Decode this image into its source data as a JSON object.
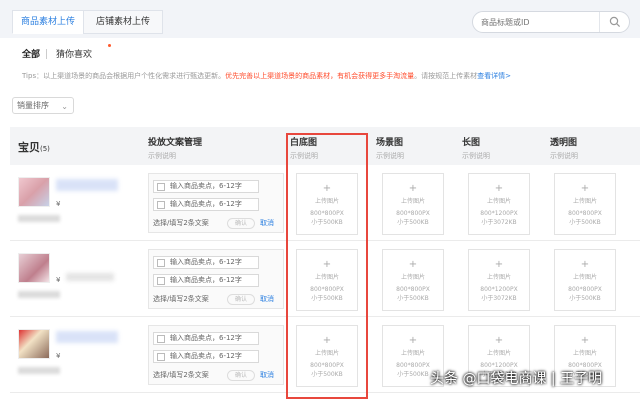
{
  "tabs": [
    {
      "label": "商品素材上传",
      "active": true
    },
    {
      "label": "店铺素材上传",
      "active": false
    }
  ],
  "search": {
    "placeholder": "商品标题或ID"
  },
  "subtabs": [
    "全部",
    "猜你喜欢"
  ],
  "tips": {
    "prefix": "Tips：以上渠道场景的商品会根据用户个性化需求进行甄选更新。",
    "highlight": "优先完善以上渠道场景的商品素材，有机会获得更多手淘流量",
    "suffix": "。请按规范上传素材",
    "link": "查看详情>"
  },
  "sort": {
    "label": "销量排序"
  },
  "table": {
    "product_col": {
      "title": "宝贝",
      "count": "(5)"
    },
    "columns": [
      {
        "title": "投放文案管理",
        "sub": "示例说明"
      },
      {
        "title": "白底图",
        "sub": "示例说明"
      },
      {
        "title": "场景图",
        "sub": "示例说明"
      },
      {
        "title": "长图",
        "sub": "示例说明"
      },
      {
        "title": "透明图",
        "sub": "示例说明"
      }
    ]
  },
  "copy_editor": {
    "input_placeholder": "输入商品卖点，6-12字",
    "footer": "选择/填写2条文案",
    "confirm": "确认",
    "cancel": "取消"
  },
  "upload": {
    "plus": "+",
    "label": "上传图片",
    "size_800": "800*800PX",
    "size_1200": "800*1200PX",
    "limit_500": "小于500KB",
    "limit_3072": "小于3072KB"
  },
  "rows": [
    {
      "price_symbol": "¥"
    },
    {
      "price_symbol": "¥"
    },
    {
      "price_symbol": "¥"
    }
  ],
  "watermark": "头条 @口袋电商课 | 王子明",
  "colors": {
    "accent": "#2b7fe0",
    "warning": "#ff4d2d",
    "highlight_border": "#e8473d"
  }
}
